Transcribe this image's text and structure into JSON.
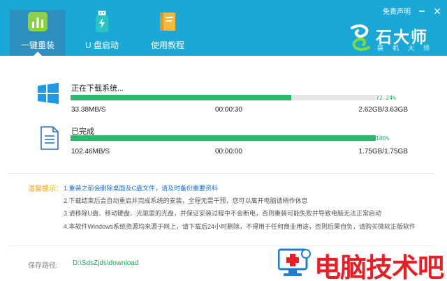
{
  "header": {
    "disclaimer": "免责声明",
    "tabs": [
      {
        "label": "一键重装",
        "icon": "bar-chart-icon",
        "active": true
      },
      {
        "label": "U 盘启动",
        "icon": "usb-drive-icon",
        "active": false
      },
      {
        "label": "使用教程",
        "icon": "book-icon",
        "active": false
      }
    ],
    "brand": {
      "name": "石大师",
      "sub": "装机大师"
    }
  },
  "downloads": [
    {
      "title": "正在下载系统...",
      "icon": "windows-icon",
      "progress_percent": 72.24,
      "progress_text": "72.24%",
      "speed": "33.38MB/S",
      "elapsed": "00:00:30",
      "size": "2.62GB/3.63GB"
    },
    {
      "title": "已完成",
      "icon": "document-icon",
      "progress_percent": 100,
      "progress_text": "100%",
      "speed": "102.46MB/S",
      "elapsed": "00:00:00",
      "size": "1.75GB/1.75GB"
    }
  ],
  "tips": {
    "label": "温馨提示：",
    "items": [
      "1.重装之前会删除桌面及C盘文件，请及时备份重要资料",
      "2.下载结束后会自动重启并完成系统的安装，全程无需干预，您可以离开电脑请稍作休息",
      "3.请移除U盘、移动硬盘、光驱里的光盘，并保证安装过程中不会断电，否则重装可能失败并导致电脑无法正常启动",
      "4.本软件Windows系统资源均来源于网上，请下载后24小时删除，不得用于任何商业用途，否则后果自负，请购买微软正版软件"
    ]
  },
  "save_path": {
    "label": "保存路径:",
    "value": "D:\\SdsZjds\\download"
  },
  "watermark": {
    "text": "电脑技术吧"
  },
  "colors": {
    "header": "#1aa9d6",
    "progress": "#2cbb6e",
    "tip_highlight": "#1a6fd0",
    "tip_label": "#f0a028",
    "watermark": "#ea1c24"
  }
}
